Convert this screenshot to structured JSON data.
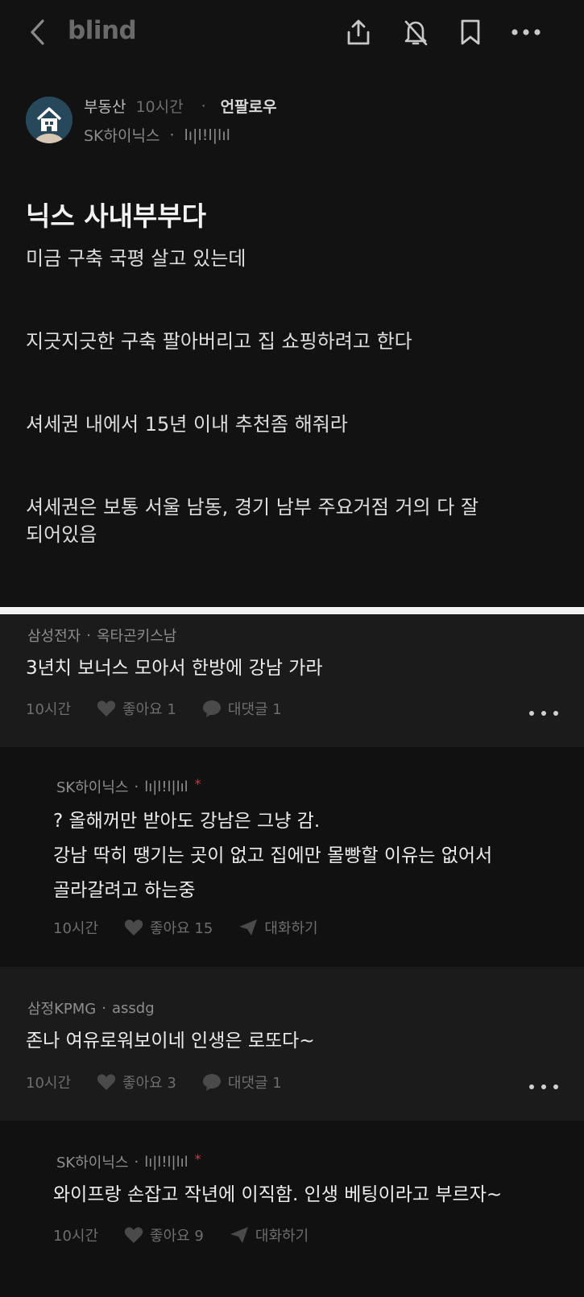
{
  "app": {
    "brand": "blind"
  },
  "post": {
    "category": "부동산",
    "time": "10시간",
    "unfollow_label": "언팔로우",
    "company": "SK하이닉스",
    "nickname": "lı|l!l|lıl",
    "title": "닉스 사내부부다",
    "body": [
      "미금 구축 국평 살고 있는데",
      "지긋지긋한 구축 팔아버리고 집 쇼핑하려고 한다",
      "셔세권 내에서 15년 이내 추천좀 해줘라",
      "셔세권은 보통 서울 남동, 경기 남부 주요거점 거의 다 잘\n되어있음"
    ]
  },
  "comments": [
    {
      "company": "삼성전자",
      "nickname": "옥타곤키스남",
      "lines": [
        "3년치 보너스 모아서 한방에 강남 가라"
      ],
      "time": "10시간",
      "likes": "좋아요 1",
      "replies": "대댓글 1"
    },
    {
      "company": "SK하이닉스",
      "nickname": "lı|l!l|lıl",
      "author_mark": "*",
      "lines": [
        "? 올해꺼만 받아도 강남은 그냥 감.",
        "강남 딱히 땡기는 곳이 없고 집에만 몰빵할 이유는 없어서",
        "골라갈려고 하는중"
      ],
      "time": "10시간",
      "likes": "좋아요 15",
      "chat": "대화하기"
    },
    {
      "company": "삼정KPMG",
      "nickname": "assdg",
      "lines": [
        "존나 여유로워보이네 인생은 로또다~"
      ],
      "time": "10시간",
      "likes": "좋아요 3",
      "replies": "대댓글 1"
    },
    {
      "company": "SK하이닉스",
      "nickname": "lı|l!l|lıl",
      "author_mark": "*",
      "lines": [
        "와이프랑 손잡고 작년에 이직함. 인생 베팅이라고 부르자~"
      ],
      "time": "10시간",
      "likes": "좋아요 9",
      "chat": "대화하기"
    }
  ]
}
